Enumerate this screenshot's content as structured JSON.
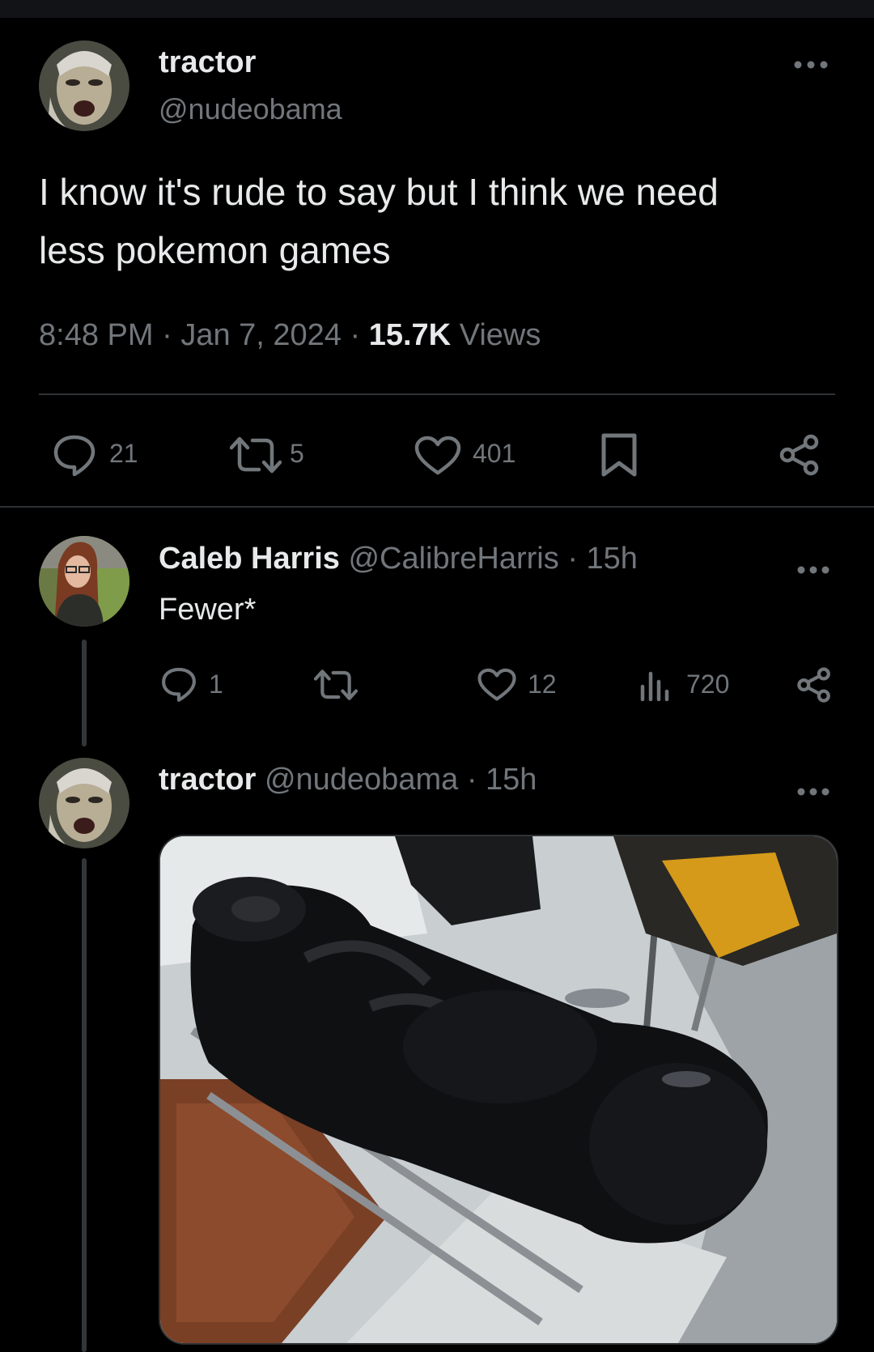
{
  "main_tweet": {
    "author_name": "tractor",
    "author_handle": "@nudeobama",
    "text_line1": "I know it's rude to say but I think we need",
    "text_line2": "less pokemon games",
    "time": "8:48 PM",
    "separator": "·",
    "date": "Jan 7, 2024",
    "views_count": "15.7K",
    "views_label": "Views",
    "replies": "21",
    "reposts": "5",
    "likes": "401",
    "more_icon": "more-icon"
  },
  "reply1": {
    "author_name": "Caleb Harris",
    "author_handle": "@CalibreHarris",
    "separator": "·",
    "age": "15h",
    "text": "Fewer*",
    "replies": "1",
    "likes": "12",
    "views": "720"
  },
  "reply2": {
    "author_name": "tractor",
    "author_handle": "@nudeobama",
    "separator": "·",
    "age": "15h"
  },
  "colors": {
    "background": "#000000",
    "text_primary": "#e7e9ea",
    "text_secondary": "#71767b",
    "divider": "#2f3336"
  }
}
